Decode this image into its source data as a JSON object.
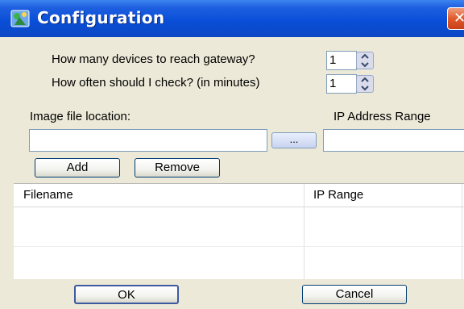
{
  "window": {
    "title": "Configuration",
    "close_label": "✕"
  },
  "settings": {
    "devices_label": "How many devices to reach gateway?",
    "devices_value": "1",
    "check_label": "How often should I check?  (in minutes)",
    "check_value": "1"
  },
  "image": {
    "location_label": "Image file location:",
    "location_value": "",
    "browse_label": "...",
    "ip_range_label": "IP Address Range",
    "ip_range_value": ""
  },
  "actions": {
    "add_label": "Add",
    "remove_label": "Remove"
  },
  "list": {
    "columns": [
      "Filename",
      "IP Range"
    ],
    "rows": []
  },
  "footer": {
    "ok_label": "OK",
    "cancel_label": "Cancel"
  },
  "colors": {
    "titlebar": "#0a4fd8",
    "close": "#e05a2a",
    "face": "#ece9d8"
  }
}
